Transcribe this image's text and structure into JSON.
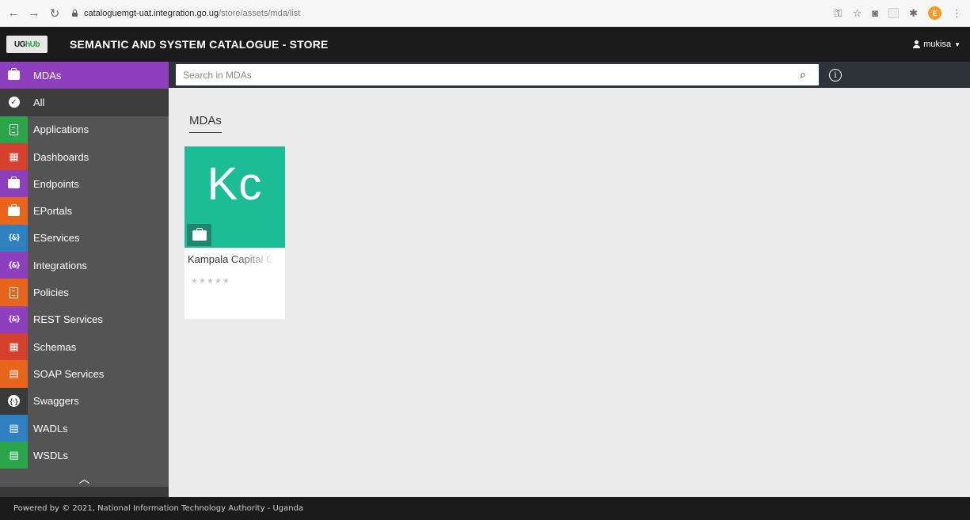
{
  "browser": {
    "url_host": "cataloguemgt-uat.integration.go.ug",
    "url_path": "/store/assets/mda/list",
    "profile_initial": "E"
  },
  "header": {
    "logo_prefix": "UG",
    "logo_suffix": "hUb",
    "title": "SEMANTIC AND SYSTEM CATALOGUE - STORE",
    "user": "mukisa"
  },
  "sidebar": {
    "items": [
      {
        "label": "MDAs",
        "icon": "briefcase-icon",
        "color": "#8d3fbd"
      },
      {
        "label": "All",
        "icon": "check-circle-icon",
        "color": "#3d3d3d"
      },
      {
        "label": "Applications",
        "icon": "document-icon",
        "color": "#2aa54a"
      },
      {
        "label": "Dashboards",
        "icon": "dashboard-icon",
        "color": "#d6412f"
      },
      {
        "label": "Endpoints",
        "icon": "briefcase-icon",
        "color": "#8d3fbd"
      },
      {
        "label": "EPortals",
        "icon": "briefcase-icon",
        "color": "#e8651b"
      },
      {
        "label": "EServices",
        "icon": "braces-icon",
        "color": "#2f80c0"
      },
      {
        "label": "Integrations",
        "icon": "braces-icon",
        "color": "#8d3fbd"
      },
      {
        "label": "Policies",
        "icon": "document-icon",
        "color": "#e8651b"
      },
      {
        "label": "REST Services",
        "icon": "braces-icon",
        "color": "#8d3fbd"
      },
      {
        "label": "Schemas",
        "icon": "dashboard-icon",
        "color": "#d6412f"
      },
      {
        "label": "SOAP Services",
        "icon": "file-code-icon",
        "color": "#e8651b"
      },
      {
        "label": "Swaggers",
        "icon": "swagger-icon",
        "color": "#3a3a3a"
      },
      {
        "label": "WADLs",
        "icon": "file-code-icon",
        "color": "#2f80c0"
      },
      {
        "label": "WSDLs",
        "icon": "file-code-icon",
        "color": "#2aa54a"
      }
    ]
  },
  "search": {
    "placeholder": "Search in MDAs"
  },
  "main": {
    "section_title": "MDAs",
    "cards": [
      {
        "initials": "Kc",
        "name": "Kampala Capital C",
        "rating": 0,
        "thumb_color": "#1cbc95"
      }
    ]
  },
  "footer": {
    "text": "Powered by © 2021, National Information Technology Authority - Uganda"
  }
}
